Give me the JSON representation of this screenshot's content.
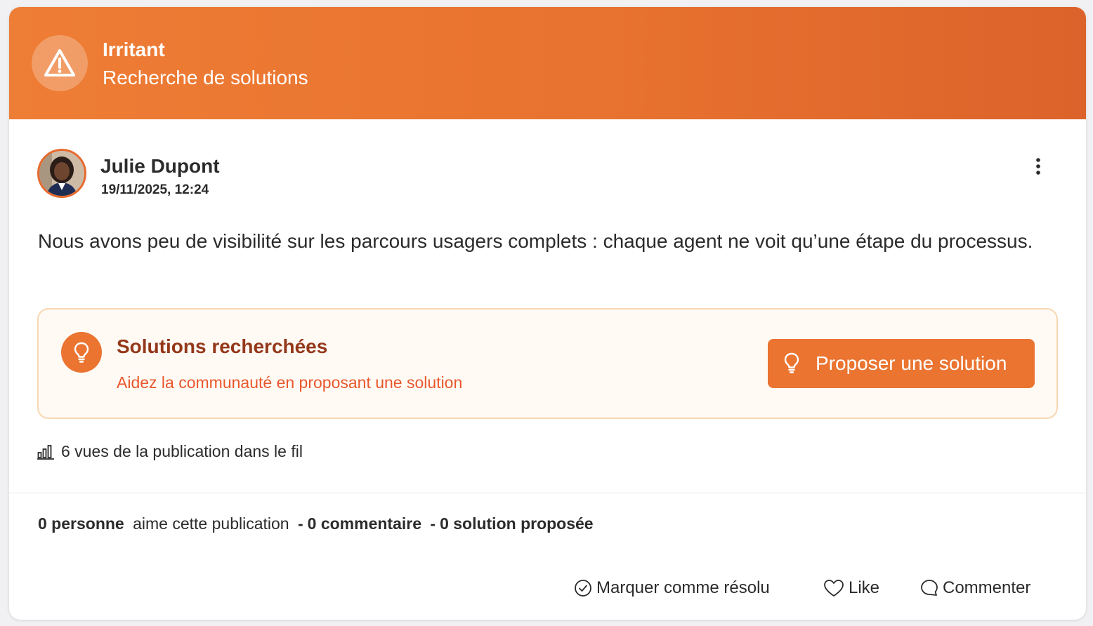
{
  "banner": {
    "title": "Irritant",
    "subtitle": "Recherche de solutions",
    "icon": "warning-triangle-icon"
  },
  "post": {
    "author": "Julie Dupont",
    "date": "19/11/2025, 12:24",
    "body": "Nous avons peu de visibilité sur les parcours usagers complets : chaque agent ne voit qu’une étape du processus."
  },
  "solutions_box": {
    "title": "Solutions recherchées",
    "subtitle": "Aidez la communauté en proposant une solution",
    "button_label": "Proposer une solution"
  },
  "views": {
    "text": "6 vues de la publication dans le fil"
  },
  "stats": {
    "likes_count": "0 personne",
    "likes_text": "aime cette publication",
    "separator": "-",
    "comments": "0 commentaire",
    "solutions": "0 solution proposée"
  },
  "actions": {
    "resolve_label": "Marquer comme résolu",
    "like_label": "Like",
    "comment_label": "Commenter"
  },
  "colors": {
    "banner_start": "#ee7d35",
    "banner_end": "#dc632b",
    "accent": "#ea7430",
    "solutions_title": "#94381a",
    "solutions_subtitle": "#e9572d"
  }
}
